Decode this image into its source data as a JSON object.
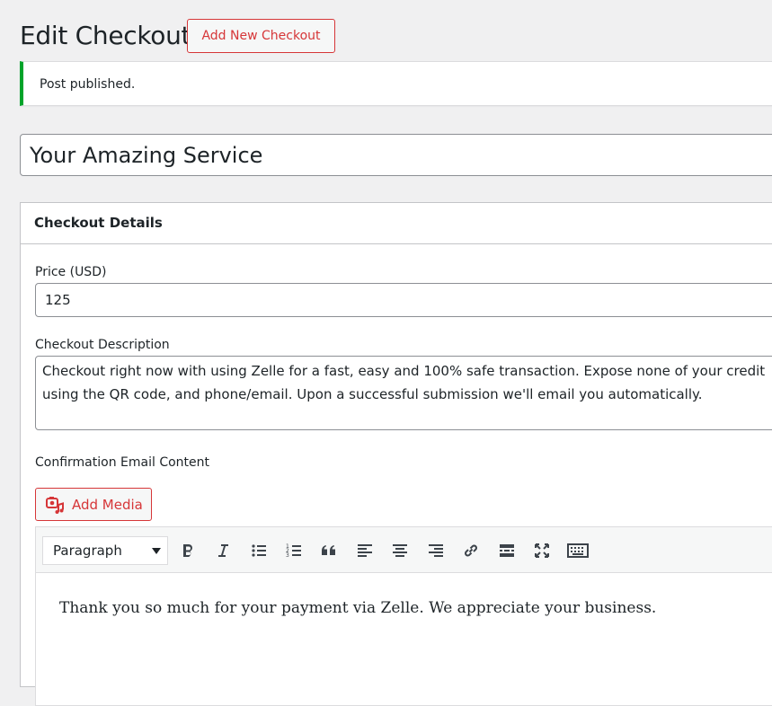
{
  "header": {
    "title": "Edit Checkout",
    "add_new_label": "Add New Checkout"
  },
  "notice": {
    "text": "Post published."
  },
  "post_title": {
    "value": "Your Amazing Service"
  },
  "metabox": {
    "title": "Checkout Details",
    "price_label": "Price (USD)",
    "price_value": "125",
    "description_label": "Checkout Description",
    "description_value": "Checkout right now with using Zelle for a fast, easy and 100% safe transaction. Expose none of your credit\nusing the QR code, and phone/email. Upon a successful submission we'll email you automatically.",
    "email_label": "Confirmation Email Content"
  },
  "editor": {
    "add_media_label": "Add Media",
    "format_selected": "Paragraph",
    "toolbar_icons": [
      "bold-icon",
      "italic-icon",
      "bullet-list-icon",
      "numbered-list-icon",
      "blockquote-icon",
      "align-left-icon",
      "align-center-icon",
      "align-right-icon",
      "link-icon",
      "read-more-icon",
      "fullscreen-icon",
      "toolbar-toggle-icon"
    ],
    "content": "Thank you so much for your payment via Zelle. We appreciate your business."
  },
  "colors": {
    "accent": "#d63638",
    "success": "#00a32a",
    "background": "#f0f0f1"
  }
}
